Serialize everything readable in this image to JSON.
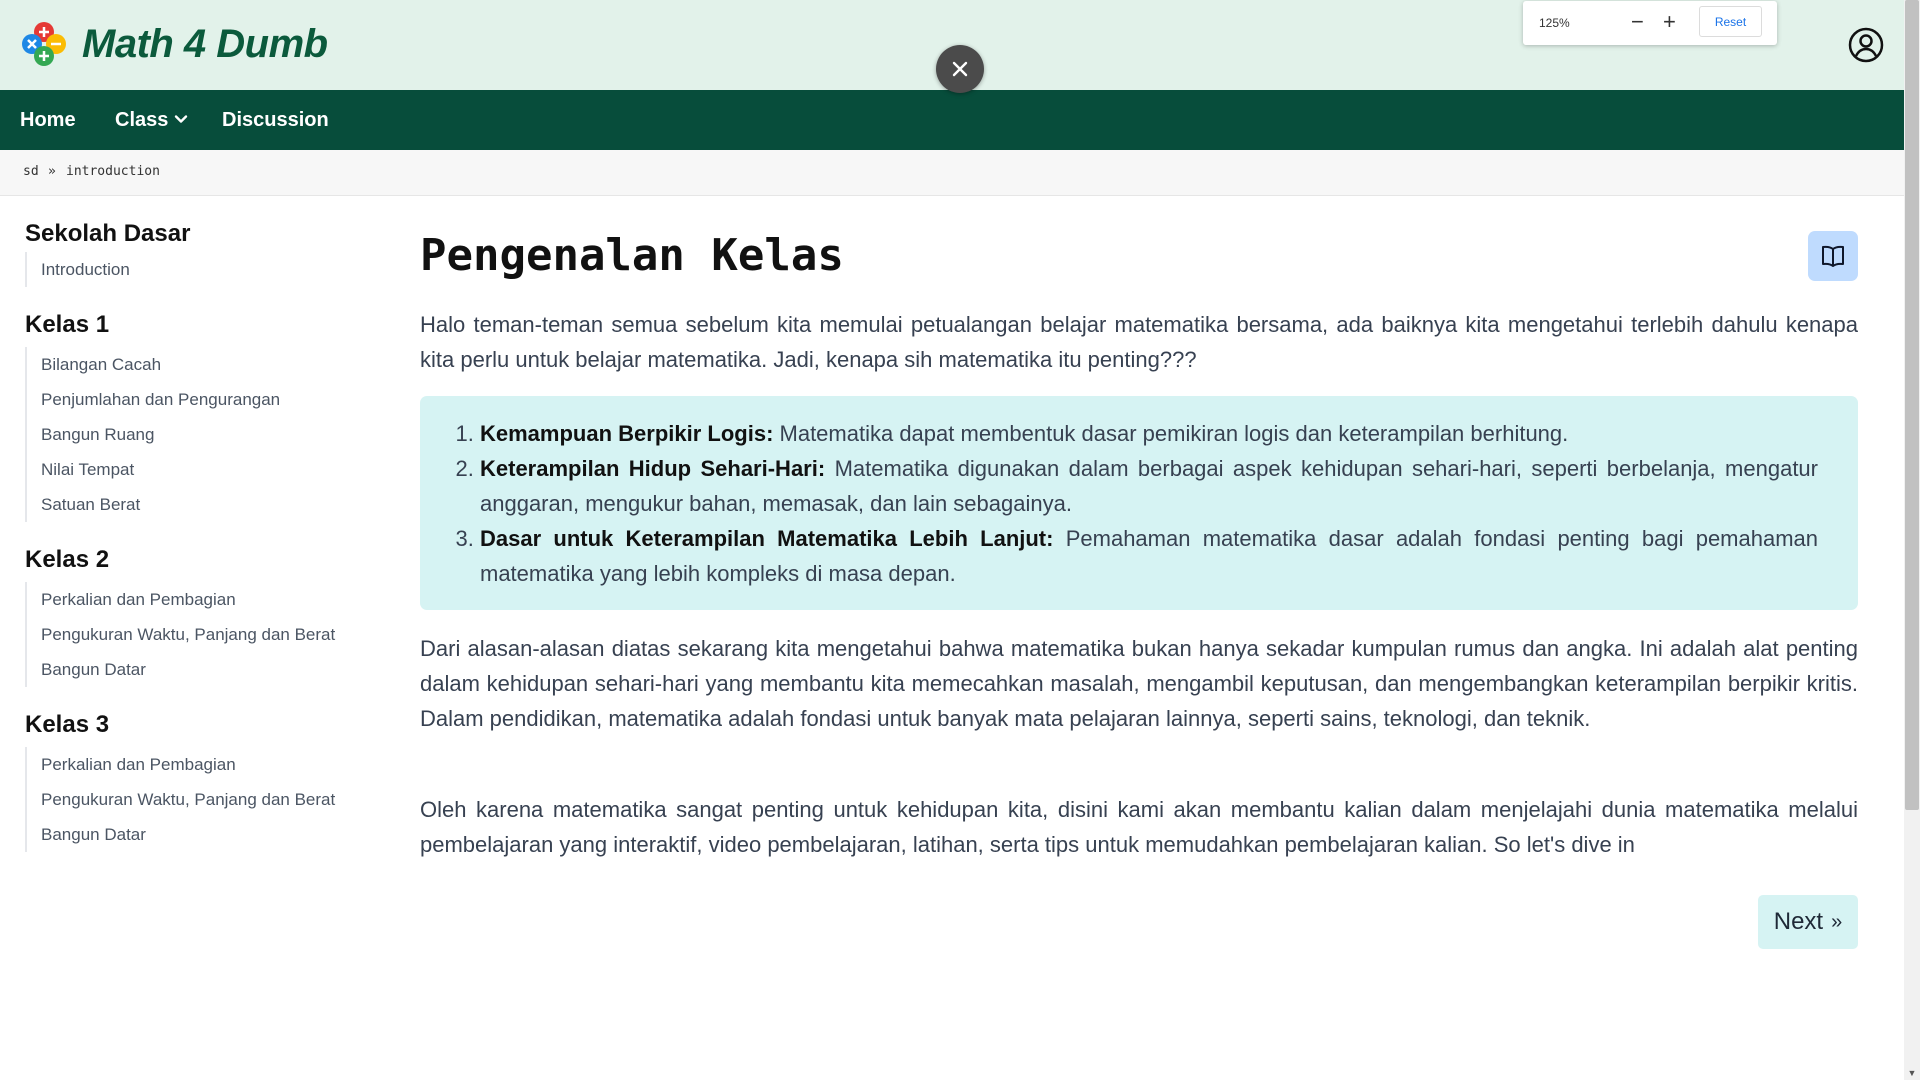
{
  "brand": {
    "name": "Math 4 Dumb",
    "colors": {
      "green": "#0b5a3c",
      "nav_bg": "#074d3b",
      "header_bg": "#e2f2ea",
      "plus": "#e53935",
      "minus": "#fbbc04",
      "times": "#1e88e5",
      "divide": "#34a853"
    }
  },
  "zoom": {
    "level": "125%",
    "minus": "−",
    "plus": "+",
    "reset": "Reset"
  },
  "overlay": {
    "close_icon": "close-icon"
  },
  "nav": {
    "home": "Home",
    "class": "Class",
    "discussion": "Discussion"
  },
  "breadcrumb": {
    "root": "sd",
    "separator": "»",
    "current": "introduction"
  },
  "sidebar": {
    "groups": [
      {
        "title": "Sekolah Dasar",
        "items": [
          "Introduction"
        ]
      },
      {
        "title": "Kelas 1",
        "items": [
          "Bilangan Cacah",
          "Penjumlahan dan Pengurangan",
          "Bangun Ruang",
          "Nilai Tempat",
          "Satuan Berat"
        ]
      },
      {
        "title": "Kelas 2",
        "items": [
          "Perkalian dan Pembagian",
          "Pengukuran Waktu, Panjang dan Berat",
          "Bangun Datar"
        ]
      },
      {
        "title": "Kelas 3",
        "items": [
          "Perkalian dan Pembagian",
          "Pengukuran Waktu, Panjang dan Berat",
          "Bangun Datar"
        ]
      }
    ]
  },
  "main": {
    "title": "Pengenalan Kelas",
    "intro": "Halo teman-teman semua sebelum kita memulai petualangan belajar matematika bersama, ada baiknya kita mengetahui terlebih dahulu kenapa kita perlu untuk belajar matematika. Jadi, kenapa sih matematika itu penting???",
    "points": [
      {
        "bold": "Kemampuan Berpikir Logis:",
        "text": " Matematika dapat membentuk dasar pemikiran logis dan keterampilan berhitung."
      },
      {
        "bold": "Keterampilan Hidup Sehari-Hari:",
        "text": " Matematika digunakan dalam berbagai aspek kehidupan sehari-hari, seperti berbelanja, mengatur anggaran, mengukur bahan, memasak, dan lain sebagainya."
      },
      {
        "bold": "Dasar untuk Keterampilan Matematika Lebih Lanjut:",
        "text": " Pemahaman matematika dasar adalah fondasi penting bagi pemahaman matematika yang lebih kompleks di masa depan."
      }
    ],
    "para2": "Dari alasan-alasan diatas sekarang kita mengetahui bahwa matematika bukan hanya sekadar kumpulan rumus dan angka. Ini adalah alat penting dalam kehidupan sehari-hari yang membantu kita memecahkan masalah, mengambil keputusan, dan mengembangkan keterampilan berpikir kritis. Dalam pendidikan, matematika adalah fondasi untuk banyak mata pelajaran lainnya, seperti sains, teknologi, dan teknik.",
    "para3": "Oleh karena matematika sangat penting untuk kehidupan kita, disini kami akan membantu kalian dalam menjelajahi dunia matematika melalui pembelajaran yang interaktif, video pembelajaran, latihan, serta tips untuk memudahkan pembelajaran kalian. So let's dive in",
    "next_label": "Next",
    "next_icon": "»"
  }
}
